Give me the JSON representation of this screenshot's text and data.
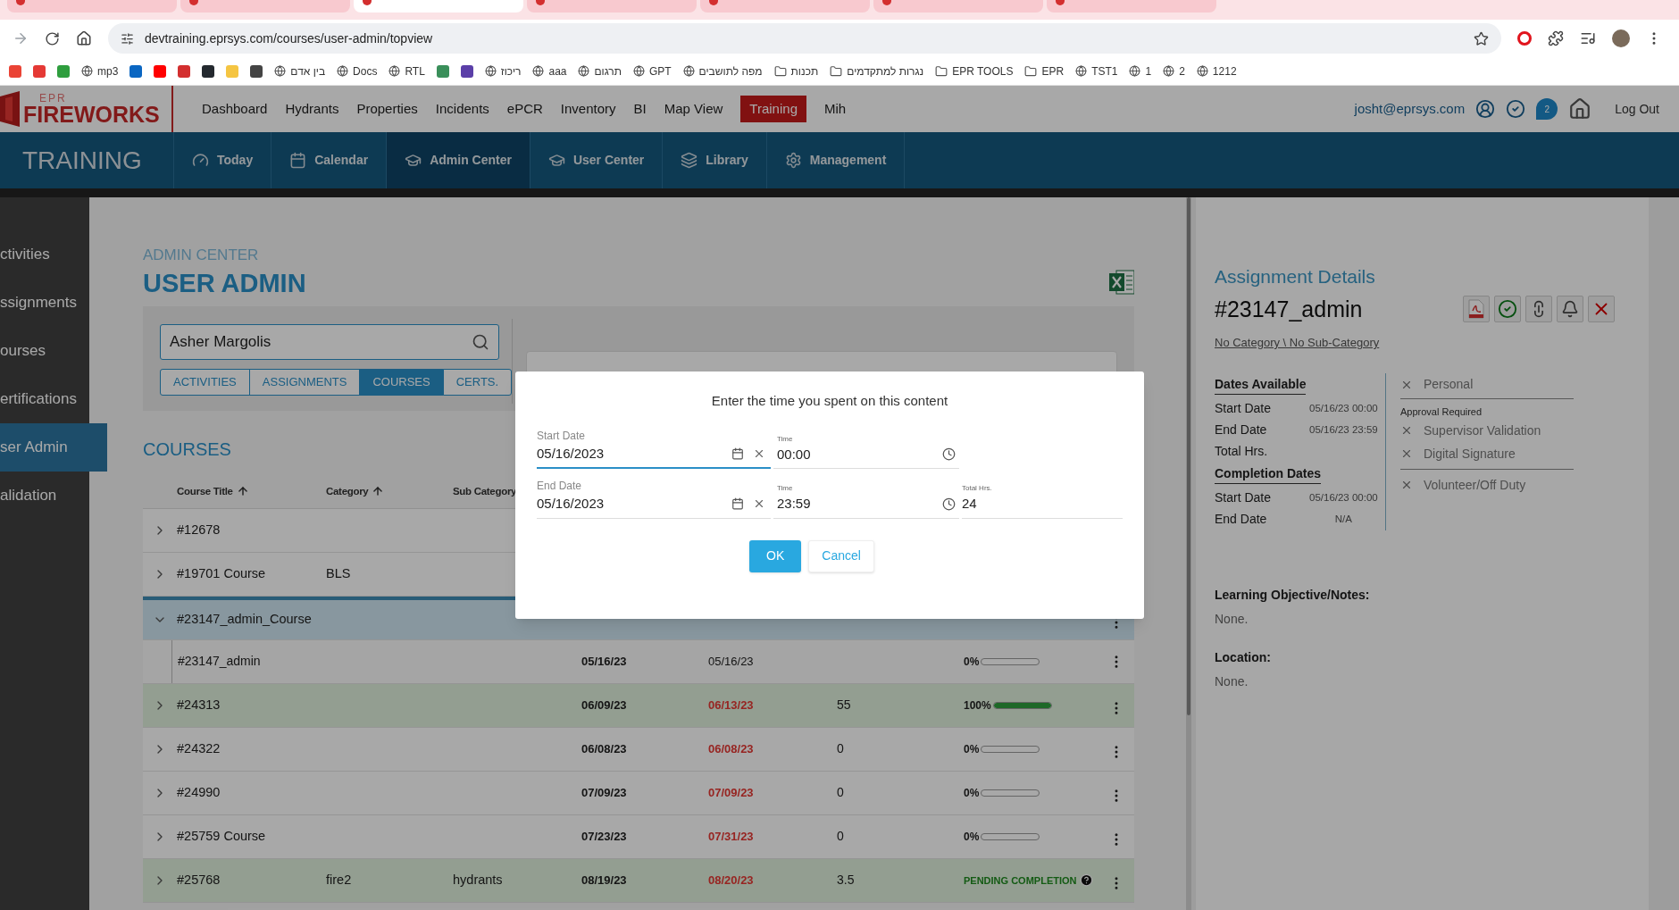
{
  "browser": {
    "tabs": [
      {
        "selected": false
      },
      {
        "selected": false
      },
      {
        "selected": true
      },
      {
        "selected": false
      },
      {
        "selected": false
      },
      {
        "selected": false
      },
      {
        "selected": false
      }
    ],
    "url": "devtraining.eprsys.com/courses/user-admin/topview",
    "bookmarks": [
      {
        "kind": "icon",
        "color": "#ea4335"
      },
      {
        "kind": "icon",
        "color": "#e53935"
      },
      {
        "kind": "icon",
        "color": "#2e9e3e"
      },
      {
        "kind": "site",
        "label": "mp3"
      },
      {
        "kind": "icon",
        "color": "#0a66c2"
      },
      {
        "kind": "icon",
        "color": "#ff0000"
      },
      {
        "kind": "icon",
        "color": "#d32f2f"
      },
      {
        "kind": "icon",
        "color": "#24292f"
      },
      {
        "kind": "icon",
        "color": "#f5c542"
      },
      {
        "kind": "icon",
        "color": "#444444"
      },
      {
        "kind": "site",
        "label": "בין אדם"
      },
      {
        "kind": "site",
        "label": "Docs"
      },
      {
        "kind": "site",
        "label": "RTL"
      },
      {
        "kind": "icon",
        "color": "#3a8f5a"
      },
      {
        "kind": "icon",
        "color": "#5b3fa8"
      },
      {
        "kind": "site",
        "label": "ריכוז"
      },
      {
        "kind": "site",
        "label": "aaa"
      },
      {
        "kind": "site",
        "label": "תרגום"
      },
      {
        "kind": "site",
        "label": "GPT"
      },
      {
        "kind": "site",
        "label": "מפה לתושבים"
      },
      {
        "kind": "folder",
        "label": "תכנות"
      },
      {
        "kind": "folder",
        "label": "נגרות למתקדמים"
      },
      {
        "kind": "folder",
        "label": "EPR TOOLS"
      },
      {
        "kind": "folder",
        "label": "EPR"
      },
      {
        "kind": "site",
        "label": "TST1"
      },
      {
        "kind": "site",
        "label": "1"
      },
      {
        "kind": "site",
        "label": "2"
      },
      {
        "kind": "site",
        "label": "1212"
      }
    ]
  },
  "nav": {
    "logo_small": "EPR",
    "logo": "FIREWORKS",
    "items": [
      {
        "label": "Dashboard",
        "selected": false
      },
      {
        "label": "Hydrants",
        "selected": false
      },
      {
        "label": "Properties",
        "selected": false
      },
      {
        "label": "Incidents",
        "selected": false
      },
      {
        "label": "ePCR",
        "selected": false
      },
      {
        "label": "Inventory",
        "selected": false
      },
      {
        "label": "BI",
        "selected": false
      },
      {
        "label": "Map View",
        "selected": false
      },
      {
        "label": "Training",
        "selected": true
      },
      {
        "label": "Mih",
        "selected": false
      }
    ],
    "user": "josht@eprsys.com",
    "chat_badge": "2",
    "logout": "Log Out"
  },
  "module": {
    "title": "TRAINING",
    "tabs": [
      {
        "label": "Today",
        "selected": false
      },
      {
        "label": "Calendar",
        "selected": false
      },
      {
        "label": "Admin Center",
        "selected": true
      },
      {
        "label": "User Center",
        "selected": false
      },
      {
        "label": "Library",
        "selected": false
      },
      {
        "label": "Management",
        "selected": false
      }
    ]
  },
  "sidebar": {
    "items": [
      {
        "label": "ctivities",
        "selected": false
      },
      {
        "label": "ssignments",
        "selected": false
      },
      {
        "label": "ourses",
        "selected": false
      },
      {
        "label": "ertifications",
        "selected": false
      },
      {
        "label": "ser Admin",
        "selected": true
      },
      {
        "label": "alidation",
        "selected": false
      }
    ]
  },
  "page": {
    "breadcrumb": "ADMIN CENTER",
    "title": "USER ADMIN",
    "search": {
      "value": "Asher Margolis"
    },
    "tabs": [
      {
        "label": "ACTIVITIES",
        "selected": false
      },
      {
        "label": "ASSIGNMENTS",
        "selected": false
      },
      {
        "label": "COURSES",
        "selected": true
      },
      {
        "label": "CERTS.",
        "selected": false
      }
    ],
    "section": "COURSES"
  },
  "table": {
    "columns": [
      {
        "label": "Course Title",
        "sorted": true
      },
      {
        "label": "Category",
        "sorted": true
      },
      {
        "label": "Sub Category"
      }
    ],
    "rows": [
      {
        "title": "#12678",
        "expanded": false,
        "selected": false,
        "completed": false
      },
      {
        "title": "#19701 Course",
        "category": "BLS",
        "expanded": false,
        "selected": false,
        "completed": false
      },
      {
        "title": "#23147_admin_Course",
        "menu": true,
        "expanded": true,
        "selected": true,
        "completed": false,
        "children": [
          {
            "title": "#23147_admin",
            "start": "05/16/23",
            "due": "05/16/23",
            "overdue": false,
            "progress": {
              "kind": "bar",
              "label": "0%",
              "level": 0
            }
          }
        ]
      },
      {
        "title": "#24313",
        "start": "06/09/23",
        "due": "06/13/23",
        "overdue": true,
        "hours": "55",
        "progress": {
          "kind": "bar",
          "label": "100%",
          "level": 1
        },
        "expanded": false,
        "selected": false,
        "completed": true
      },
      {
        "title": "#24322",
        "start": "06/08/23",
        "due": "06/08/23",
        "overdue": true,
        "hours": "0",
        "progress": {
          "kind": "bar",
          "label": "0%",
          "level": 0
        },
        "expanded": false,
        "selected": false,
        "completed": false
      },
      {
        "title": "#24990",
        "start": "07/09/23",
        "due": "07/09/23",
        "overdue": true,
        "hours": "0",
        "progress": {
          "kind": "bar",
          "label": "0%",
          "level": 0
        },
        "expanded": false,
        "selected": false,
        "completed": false
      },
      {
        "title": "#25759 Course",
        "start": "07/23/23",
        "due": "07/31/23",
        "overdue": true,
        "hours": "0",
        "progress": {
          "kind": "bar",
          "label": "0%",
          "level": 0
        },
        "expanded": false,
        "selected": false,
        "completed": false
      },
      {
        "title": "#25768",
        "category": "fire2",
        "sub_category": "hydrants",
        "start": "08/19/23",
        "due": "08/20/23",
        "overdue": true,
        "hours": "3.5",
        "progress": {
          "kind": "status",
          "label": "PENDING COMPLETION"
        },
        "expanded": false,
        "selected": false,
        "completed": true
      }
    ]
  },
  "details": {
    "heading": "Assignment Details",
    "title": "#23147_admin",
    "category_link": "No Category \\ No Sub-Category",
    "sections": [
      {
        "heading": "Dates Available",
        "rows": [
          {
            "label": "Start Date",
            "value": "05/16/23 00:00"
          },
          {
            "label": "End Date",
            "value": "05/16/23 23:59"
          },
          {
            "label": "Total Hrs."
          }
        ]
      },
      {
        "heading": "Completion Dates",
        "rows": [
          {
            "label": "Start Date",
            "value": "05/16/23 00:00"
          },
          {
            "label": "End Date",
            "value": "N/A"
          }
        ]
      }
    ],
    "options": [
      {
        "label": "Personal",
        "checked": false
      }
    ],
    "approval": {
      "heading": "Approval Required",
      "options": [
        {
          "label": "Supervisor Validation",
          "checked": false
        },
        {
          "label": "Digital Signature",
          "checked": false
        }
      ]
    },
    "extra_options": [
      {
        "label": "Volunteer/Off Duty",
        "checked": false
      }
    ],
    "notes": [
      {
        "label": "Learning Objective/Notes:",
        "value": "None."
      },
      {
        "label": "Location:",
        "value": "None."
      }
    ]
  },
  "dialog": {
    "title": "Enter the time you spent on this content",
    "rows": [
      {
        "date_label": "Start Date",
        "date": "05/16/2023",
        "focused": true,
        "time_label": "Time",
        "time": "00:00"
      },
      {
        "date_label": "End Date",
        "date": "05/16/2023",
        "focused": false,
        "time_label": "Time",
        "time": "23:59",
        "total_label": "Total Hrs.",
        "total": "24"
      }
    ],
    "buttons": [
      {
        "label": "OK",
        "kind": "primary"
      },
      {
        "label": "Cancel",
        "kind": "secondary"
      }
    ]
  }
}
